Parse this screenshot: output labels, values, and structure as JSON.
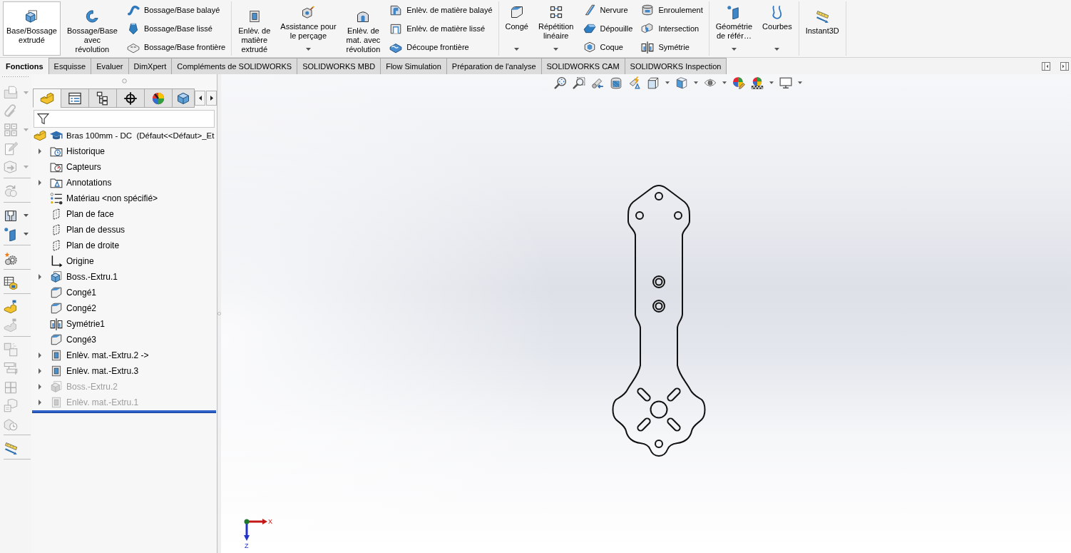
{
  "ribbon": {
    "groups": [
      {
        "commands": [
          {
            "kind": "large",
            "label": "Base/Bossage\nextrudé",
            "selected": true,
            "dropdown": false
          },
          {
            "kind": "large",
            "label": "Bossage/Base\navec\nrévolution",
            "selected": false,
            "dropdown": false
          },
          {
            "kind": "stack",
            "items": [
              {
                "label": "Bossage/Base balayé",
                "selected": false
              },
              {
                "label": "Bossage/Base lissé",
                "selected": false
              },
              {
                "label": "Bossage/Base frontière",
                "selected": false
              }
            ]
          }
        ]
      },
      {
        "commands": [
          {
            "kind": "large",
            "label": "Enlèv. de\nmatière\nextrudé",
            "selected": false,
            "dropdown": false
          },
          {
            "kind": "large",
            "label": "Assistance pour\nle perçage",
            "selected": false,
            "dropdown": true
          },
          {
            "kind": "large",
            "label": "Enlèv. de\nmat. avec\nrévolution",
            "selected": false,
            "dropdown": false
          },
          {
            "kind": "stack",
            "items": [
              {
                "label": "Enlèv. de matière balayé",
                "selected": false
              },
              {
                "label": "Enlèv. de matière lissé",
                "selected": false
              },
              {
                "label": "Découpe frontière",
                "selected": false
              }
            ]
          }
        ]
      },
      {
        "commands": [
          {
            "kind": "large",
            "label": "Congé",
            "selected": false,
            "dropdown": true
          },
          {
            "kind": "large",
            "label": "Répétition\nlinéaire",
            "selected": false,
            "dropdown": true
          },
          {
            "kind": "stack",
            "items": [
              {
                "label": "Nervure",
                "selected": false
              },
              {
                "label": "Dépouille",
                "selected": false
              },
              {
                "label": "Coque",
                "selected": false
              }
            ]
          },
          {
            "kind": "stack",
            "items": [
              {
                "label": "Enroulement",
                "selected": false
              },
              {
                "label": "Intersection",
                "selected": false
              },
              {
                "label": "Symétrie",
                "selected": false
              }
            ]
          }
        ]
      },
      {
        "commands": [
          {
            "kind": "large",
            "label": "Géométrie\nde référ…",
            "selected": false,
            "dropdown": true
          },
          {
            "kind": "large",
            "label": "Courbes",
            "selected": false,
            "dropdown": true
          }
        ]
      },
      {
        "commands": [
          {
            "kind": "large",
            "label": "Instant3D",
            "selected": false,
            "dropdown": false
          }
        ]
      }
    ]
  },
  "tabs": [
    {
      "label": "Fonctions",
      "selected": true
    },
    {
      "label": "Esquisse",
      "selected": false
    },
    {
      "label": "Evaluer",
      "selected": false
    },
    {
      "label": "DimXpert",
      "selected": false
    },
    {
      "label": "Compléments de SOLIDWORKS",
      "selected": false
    },
    {
      "label": "SOLIDWORKS MBD",
      "selected": false
    },
    {
      "label": "Flow Simulation",
      "selected": false
    },
    {
      "label": "Préparation de l'analyse",
      "selected": false
    },
    {
      "label": "SOLIDWORKS CAM",
      "selected": false
    },
    {
      "label": "SOLIDWORKS Inspection",
      "selected": false
    }
  ],
  "command_toolbar": {
    "groups": [
      {
        "tools": [
          {
            "disabled": true,
            "dropdown": true
          },
          {
            "disabled": true,
            "dropdown": false
          },
          {
            "disabled": true,
            "dropdown": true
          },
          {
            "disabled": true,
            "dropdown": false
          },
          {
            "disabled": true,
            "dropdown": true
          }
        ]
      },
      {
        "tools": [
          {
            "disabled": true,
            "dropdown": false
          }
        ]
      },
      {
        "tools": [
          {
            "disabled": false,
            "dropdown": true
          },
          {
            "disabled": false,
            "dropdown": true
          }
        ]
      },
      {
        "tools": [
          {
            "disabled": false,
            "dropdown": false
          }
        ]
      },
      {
        "tools": [
          {
            "disabled": false,
            "dropdown": false
          }
        ]
      },
      {
        "tools": [
          {
            "disabled": false,
            "dropdown": false
          },
          {
            "disabled": true,
            "dropdown": false
          }
        ]
      },
      {
        "tools": [
          {
            "disabled": true,
            "dropdown": false
          },
          {
            "disabled": true,
            "dropdown": false
          },
          {
            "disabled": true,
            "dropdown": false
          },
          {
            "disabled": true,
            "dropdown": false
          },
          {
            "disabled": true,
            "dropdown": false
          }
        ]
      },
      {
        "tools": [
          {
            "disabled": false,
            "dropdown": false
          }
        ]
      }
    ]
  },
  "feature_manager": {
    "panel_tabs": [
      {
        "selected": true
      },
      {
        "selected": false
      },
      {
        "selected": false
      },
      {
        "selected": false
      },
      {
        "selected": false
      },
      {
        "selected": false
      }
    ],
    "tree": {
      "kind": "part",
      "label": "Bras 100mm - DC  (Défaut<<Défaut>_Et",
      "children": [
        {
          "kind": "history",
          "label": "Historique",
          "expanded": false,
          "suppressed": false
        },
        {
          "kind": "sensors",
          "label": "Capteurs",
          "suppressed": false
        },
        {
          "kind": "annotations",
          "label": "Annotations",
          "expanded": false,
          "suppressed": false
        },
        {
          "kind": "material",
          "label": "Matériau <non spécifié>",
          "suppressed": false
        },
        {
          "kind": "plane",
          "label": "Plan de face",
          "suppressed": false
        },
        {
          "kind": "plane",
          "label": "Plan de dessus",
          "suppressed": false
        },
        {
          "kind": "plane",
          "label": "Plan de droite",
          "suppressed": false
        },
        {
          "kind": "origin",
          "label": "Origine",
          "suppressed": false
        },
        {
          "kind": "boss",
          "label": "Boss.-Extru.1",
          "expanded": false,
          "suppressed": false
        },
        {
          "kind": "fillet",
          "label": "Congé1",
          "suppressed": false
        },
        {
          "kind": "fillet",
          "label": "Congé2",
          "suppressed": false
        },
        {
          "kind": "mirror",
          "label": "Symétrie1",
          "suppressed": false
        },
        {
          "kind": "fillet",
          "label": "Congé3",
          "suppressed": false
        },
        {
          "kind": "cut",
          "label": "Enlèv. mat.-Extru.2 ->",
          "expanded": false,
          "suppressed": false
        },
        {
          "kind": "cut",
          "label": "Enlèv. mat.-Extru.3",
          "expanded": false,
          "suppressed": false
        },
        {
          "kind": "boss",
          "label": "Boss.-Extru.2",
          "expanded": false,
          "suppressed": true
        },
        {
          "kind": "cut",
          "label": "Enlèv. mat.-Extru.1",
          "expanded": false,
          "suppressed": true
        }
      ]
    }
  },
  "view_toolbar": {
    "tools": [
      {
        "dropdown": false
      },
      {
        "dropdown": false
      },
      {
        "dropdown": false
      },
      {
        "dropdown": false
      },
      {
        "dropdown": false
      },
      {
        "dropdown": true
      },
      {
        "dropdown": true
      },
      {
        "dropdown": true
      },
      {
        "dropdown": false
      },
      {
        "dropdown": true
      },
      {
        "dropdown": true
      }
    ]
  },
  "viewport": {
    "triad": {
      "x_label": "X",
      "z_label": "Z"
    }
  }
}
